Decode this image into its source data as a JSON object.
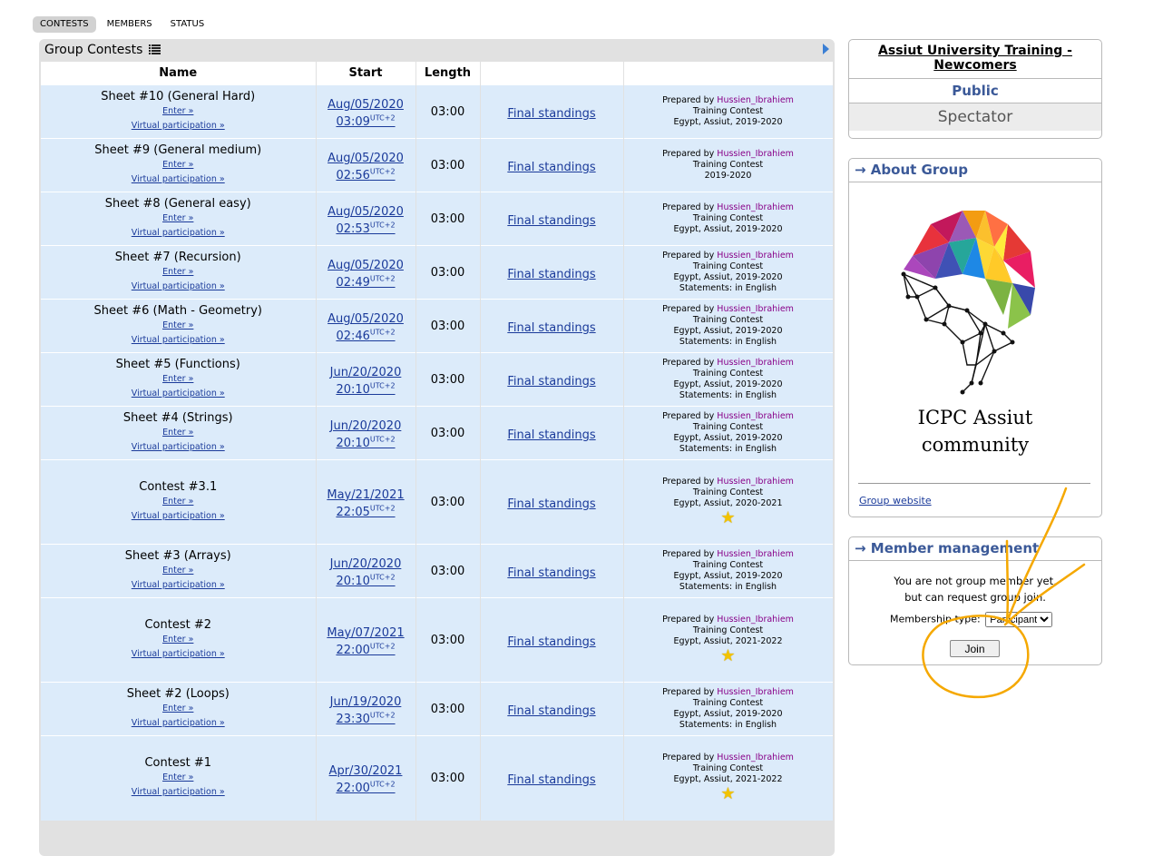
{
  "tabs": [
    {
      "label": "CONTESTS",
      "active": true
    },
    {
      "label": "MEMBERS",
      "active": false
    },
    {
      "label": "STATUS",
      "active": false
    }
  ],
  "panel": {
    "title": "Group Contests",
    "columns": [
      "Name",
      "Start",
      "Length",
      "",
      ""
    ]
  },
  "contests": [
    {
      "name": "Sheet #10 (General Hard)",
      "enter": "Enter »",
      "virtual": "Virtual participation »",
      "date": "Aug/05/2020",
      "time": "03:09",
      "tz": "UTC+2",
      "length": "03:00",
      "standings": "Final standings",
      "prepared": "Prepared by",
      "author": "Hussien_Ibrahiem",
      "type": "Training Contest",
      "season": "Egypt, Assiut, 2019-2020",
      "statements": "",
      "star": false
    },
    {
      "name": "Sheet #9 (General medium)",
      "enter": "Enter »",
      "virtual": "Virtual participation »",
      "date": "Aug/05/2020",
      "time": "02:56",
      "tz": "UTC+2",
      "length": "03:00",
      "standings": "Final standings",
      "prepared": "Prepared by",
      "author": "Hussien_Ibrahiem",
      "type": "Training Contest",
      "season": "2019-2020",
      "statements": "",
      "star": false
    },
    {
      "name": "Sheet #8 (General easy)",
      "enter": "Enter »",
      "virtual": "Virtual participation »",
      "date": "Aug/05/2020",
      "time": "02:53",
      "tz": "UTC+2",
      "length": "03:00",
      "standings": "Final standings",
      "prepared": "Prepared by",
      "author": "Hussien_Ibrahiem",
      "type": "Training Contest",
      "season": "Egypt, Assiut, 2019-2020",
      "statements": "",
      "star": false
    },
    {
      "name": "Sheet #7 (Recursion)",
      "enter": "Enter »",
      "virtual": "Virtual participation »",
      "date": "Aug/05/2020",
      "time": "02:49",
      "tz": "UTC+2",
      "length": "03:00",
      "standings": "Final standings",
      "prepared": "Prepared by",
      "author": "Hussien_Ibrahiem",
      "type": "Training Contest",
      "season": "Egypt, Assiut, 2019-2020",
      "statements": "Statements: in English",
      "star": false
    },
    {
      "name": "Sheet #6 (Math - Geometry)",
      "enter": "Enter »",
      "virtual": "Virtual participation »",
      "date": "Aug/05/2020",
      "time": "02:46",
      "tz": "UTC+2",
      "length": "03:00",
      "standings": "Final standings",
      "prepared": "Prepared by",
      "author": "Hussien_Ibrahiem",
      "type": "Training Contest",
      "season": "Egypt, Assiut, 2019-2020",
      "statements": "Statements: in English",
      "star": false
    },
    {
      "name": "Sheet #5 (Functions)",
      "enter": "Enter »",
      "virtual": "Virtual participation »",
      "date": "Jun/20/2020",
      "time": "20:10",
      "tz": "UTC+2",
      "length": "03:00",
      "standings": "Final standings",
      "prepared": "Prepared by",
      "author": "Hussien_Ibrahiem",
      "type": "Training Contest",
      "season": "Egypt, Assiut, 2019-2020",
      "statements": "Statements: in English",
      "star": false
    },
    {
      "name": "Sheet #4 (Strings)",
      "enter": "Enter »",
      "virtual": "Virtual participation »",
      "date": "Jun/20/2020",
      "time": "20:10",
      "tz": "UTC+2",
      "length": "03:00",
      "standings": "Final standings",
      "prepared": "Prepared by",
      "author": "Hussien_Ibrahiem",
      "type": "Training Contest",
      "season": "Egypt, Assiut, 2019-2020",
      "statements": "Statements: in English",
      "star": false
    },
    {
      "name": "Contest #3.1",
      "enter": "Enter »",
      "virtual": "Virtual participation »",
      "date": "May/21/2021",
      "time": "22:05",
      "tz": "UTC+2",
      "length": "03:00",
      "standings": "Final standings",
      "prepared": "Prepared by",
      "author": "Hussien_Ibrahiem",
      "type": "Training Contest",
      "season": "Egypt, Assiut, 2020-2021",
      "statements": "",
      "star": true
    },
    {
      "name": "Sheet #3 (Arrays)",
      "enter": "Enter »",
      "virtual": "Virtual participation »",
      "date": "Jun/20/2020",
      "time": "20:10",
      "tz": "UTC+2",
      "length": "03:00",
      "standings": "Final standings",
      "prepared": "Prepared by",
      "author": "Hussien_Ibrahiem",
      "type": "Training Contest",
      "season": "Egypt, Assiut, 2019-2020",
      "statements": "Statements: in English",
      "star": false
    },
    {
      "name": "Contest #2",
      "enter": "Enter »",
      "virtual": "Virtual participation »",
      "date": "May/07/2021",
      "time": "22:00",
      "tz": "UTC+2",
      "length": "03:00",
      "standings": "Final standings",
      "prepared": "Prepared by",
      "author": "Hussien_Ibrahiem",
      "type": "Training Contest",
      "season": "Egypt, Assiut, 2021-2022",
      "statements": "",
      "star": true
    },
    {
      "name": "Sheet #2 (Loops)",
      "enter": "Enter »",
      "virtual": "Virtual participation »",
      "date": "Jun/19/2020",
      "time": "23:30",
      "tz": "UTC+2",
      "length": "03:00",
      "standings": "Final standings",
      "prepared": "Prepared by",
      "author": "Hussien_Ibrahiem",
      "type": "Training Contest",
      "season": "Egypt, Assiut, 2019-2020",
      "statements": "Statements: in English",
      "star": false
    },
    {
      "name": "Contest #1",
      "enter": "Enter »",
      "virtual": "Virtual participation »",
      "date": "Apr/30/2021",
      "time": "22:00",
      "tz": "UTC+2",
      "length": "03:00",
      "standings": "Final standings",
      "prepared": "Prepared by",
      "author": "Hussien_Ibrahiem",
      "type": "Training Contest",
      "season": "Egypt, Assiut, 2021-2022",
      "statements": "",
      "star": true
    }
  ],
  "group": {
    "title": "Assiut University Training - Newcomers",
    "visibility": "Public",
    "role": "Spectator"
  },
  "about": {
    "heading": "→ About Group",
    "logo_line1": "ICPC Assiut",
    "logo_line2": "community",
    "website": "Group website"
  },
  "membership": {
    "heading": "→ Member management",
    "msg1": "You are not group member yet,",
    "msg2": "but can request group join.",
    "type_label": "Membership type:",
    "type_value": "Participant",
    "join": "Join"
  },
  "colors": {
    "row_bg": "#dcebfa",
    "link": "#1a3a9a",
    "author": "#880088",
    "heading": "#3b5998",
    "annotation": "#f5a800"
  }
}
